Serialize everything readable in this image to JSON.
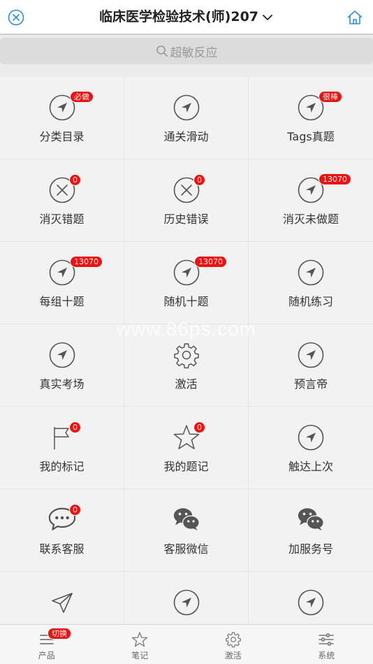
{
  "header": {
    "title": "临床医学检验技术(师)207",
    "close_icon": "close-circle-icon",
    "home_icon": "home-icon",
    "accent_color": "#2d8ce3"
  },
  "search": {
    "placeholder": "超敏反应"
  },
  "grid": [
    {
      "label": "分类目录",
      "icon": "navigation-arrow-icon",
      "badge": "必做"
    },
    {
      "label": "通关滑动",
      "icon": "navigation-arrow-icon",
      "badge": ""
    },
    {
      "label": "Tags真题",
      "icon": "navigation-arrow-icon",
      "badge": "很棒"
    },
    {
      "label": "消灭错题",
      "icon": "x-circle-icon",
      "badge": "0"
    },
    {
      "label": "历史错误",
      "icon": "x-circle-icon",
      "badge": "0"
    },
    {
      "label": "消灭未做题",
      "icon": "navigation-arrow-icon",
      "badge": "13070"
    },
    {
      "label": "每组十题",
      "icon": "navigation-arrow-icon",
      "badge": "13070"
    },
    {
      "label": "随机十题",
      "icon": "navigation-arrow-icon",
      "badge": "13070"
    },
    {
      "label": "随机练习",
      "icon": "navigation-arrow-icon",
      "badge": ""
    },
    {
      "label": "真实考场",
      "icon": "navigation-arrow-icon",
      "badge": ""
    },
    {
      "label": "激活",
      "icon": "gear-icon",
      "badge": ""
    },
    {
      "label": "预言帝",
      "icon": "navigation-arrow-icon",
      "badge": ""
    },
    {
      "label": "我的标记",
      "icon": "flag-icon",
      "badge": "0"
    },
    {
      "label": "我的题记",
      "icon": "star-icon",
      "badge": "0"
    },
    {
      "label": "触达上次",
      "icon": "navigation-arrow-icon",
      "badge": ""
    },
    {
      "label": "联系客服",
      "icon": "chat-bubble-icon",
      "badge": "0"
    },
    {
      "label": "客服微信",
      "icon": "wechat-icon",
      "badge": ""
    },
    {
      "label": "加服务号",
      "icon": "wechat-icon",
      "badge": ""
    },
    {
      "label": "",
      "icon": "send-icon",
      "badge": ""
    },
    {
      "label": "",
      "icon": "navigation-arrow-icon",
      "badge": ""
    },
    {
      "label": "",
      "icon": "navigation-arrow-icon",
      "badge": ""
    }
  ],
  "watermark": "www.86ps.com",
  "bottom_nav": [
    {
      "label": "产品",
      "icon": "menu-icon",
      "badge": "切换"
    },
    {
      "label": "笔记",
      "icon": "star-icon",
      "badge": ""
    },
    {
      "label": "激活",
      "icon": "gear-icon",
      "badge": ""
    },
    {
      "label": "系统",
      "icon": "sliders-icon",
      "badge": ""
    }
  ],
  "colors": {
    "badge": "#ee1111",
    "icon_stroke": "#555555"
  }
}
